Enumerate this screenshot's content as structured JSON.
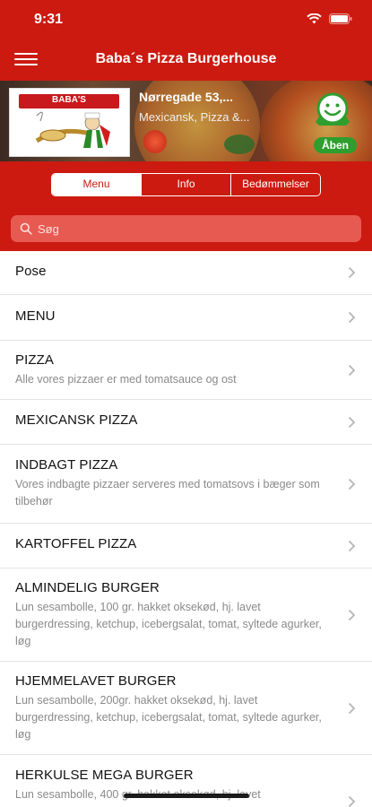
{
  "status": {
    "time": "9:31"
  },
  "nav": {
    "title": "Baba´s Pizza Burgerhouse"
  },
  "hero": {
    "logo_text": "BABA'S",
    "address": "Nørregade 53,...",
    "cuisine": "Mexicansk, Pizza &...",
    "open_label": "Åben"
  },
  "tabs": [
    {
      "label": "Menu",
      "active": true
    },
    {
      "label": "Info",
      "active": false
    },
    {
      "label": "Bedømmelser",
      "active": false
    }
  ],
  "search": {
    "placeholder": "Søg"
  },
  "categories": [
    {
      "title": "Pose",
      "desc": ""
    },
    {
      "title": "MENU",
      "desc": ""
    },
    {
      "title": "PIZZA",
      "desc": "Alle vores pizzaer er med tomatsauce og ost"
    },
    {
      "title": "MEXICANSK PIZZA",
      "desc": ""
    },
    {
      "title": "INDBAGT PIZZA",
      "desc": "Vores indbagte pizzaer serveres med tomatsovs i bæger som tilbehør"
    },
    {
      "title": "KARTOFFEL PIZZA",
      "desc": ""
    },
    {
      "title": "ALMINDELIG BURGER",
      "desc": "Lun sesambolle, 100 gr. hakket oksekød, hj. lavet burgerdressing, ketchup, icebergsalat, tomat, syltede agurker, løg"
    },
    {
      "title": "HJEMMELAVET BURGER",
      "desc": "Lun sesambolle, 200gr. hakket oksekød, hj. lavet burgerdressing, ketchup, icebergsalat, tomat, syltede agurker, løg"
    },
    {
      "title": "HERKULSE MEGA BURGER",
      "desc": "Lun sesambolle, 400 gr. hakket oksekød, hj. lavet"
    }
  ],
  "colors": {
    "brand": "#cc1a10",
    "open": "#2e9e2e"
  }
}
